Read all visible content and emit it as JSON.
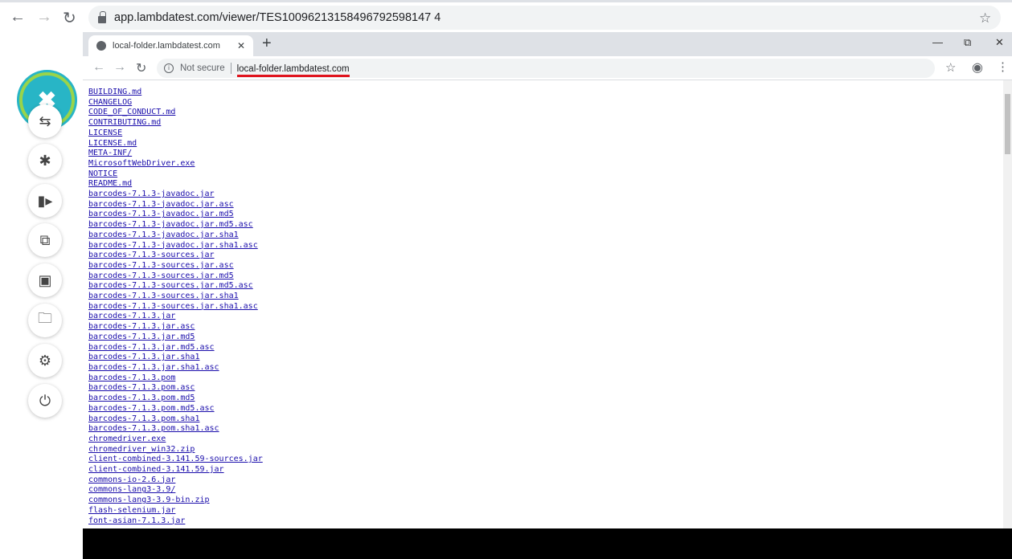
{
  "outer": {
    "url": "app.lambdatest.com/viewer/TES10096213158496792598147 4"
  },
  "inner": {
    "tab_title": "local-folder.lambdatest.com",
    "not_secure": "Not secure",
    "host": "local-folder.lambdatest.com"
  },
  "sidebar": {
    "accent": "#28b5c6",
    "ring": "#9ad44a"
  },
  "files": [
    "BUILDING.md",
    "CHANGELOG",
    "CODE_OF_CONDUCT.md",
    "CONTRIBUTING.md",
    "LICENSE",
    "LICENSE.md",
    "META-INF/",
    "MicrosoftWebDriver.exe",
    "NOTICE",
    "README.md",
    "barcodes-7.1.3-javadoc.jar",
    "barcodes-7.1.3-javadoc.jar.asc",
    "barcodes-7.1.3-javadoc.jar.md5",
    "barcodes-7.1.3-javadoc.jar.md5.asc",
    "barcodes-7.1.3-javadoc.jar.sha1",
    "barcodes-7.1.3-javadoc.jar.sha1.asc",
    "barcodes-7.1.3-sources.jar",
    "barcodes-7.1.3-sources.jar.asc",
    "barcodes-7.1.3-sources.jar.md5",
    "barcodes-7.1.3-sources.jar.md5.asc",
    "barcodes-7.1.3-sources.jar.sha1",
    "barcodes-7.1.3-sources.jar.sha1.asc",
    "barcodes-7.1.3.jar",
    "barcodes-7.1.3.jar.asc",
    "barcodes-7.1.3.jar.md5",
    "barcodes-7.1.3.jar.md5.asc",
    "barcodes-7.1.3.jar.sha1",
    "barcodes-7.1.3.jar.sha1.asc",
    "barcodes-7.1.3.pom",
    "barcodes-7.1.3.pom.asc",
    "barcodes-7.1.3.pom.md5",
    "barcodes-7.1.3.pom.md5.asc",
    "barcodes-7.1.3.pom.sha1",
    "barcodes-7.1.3.pom.sha1.asc",
    "chromedriver.exe",
    "chromedriver_win32.zip",
    "client-combined-3.141.59-sources.jar",
    "client-combined-3.141.59.jar",
    "commons-io-2.6.jar",
    "commons-lang3-3.9/",
    "commons-lang3-3.9-bin.zip",
    "flash-selenium.jar",
    "font-asian-7.1.3.jar"
  ]
}
